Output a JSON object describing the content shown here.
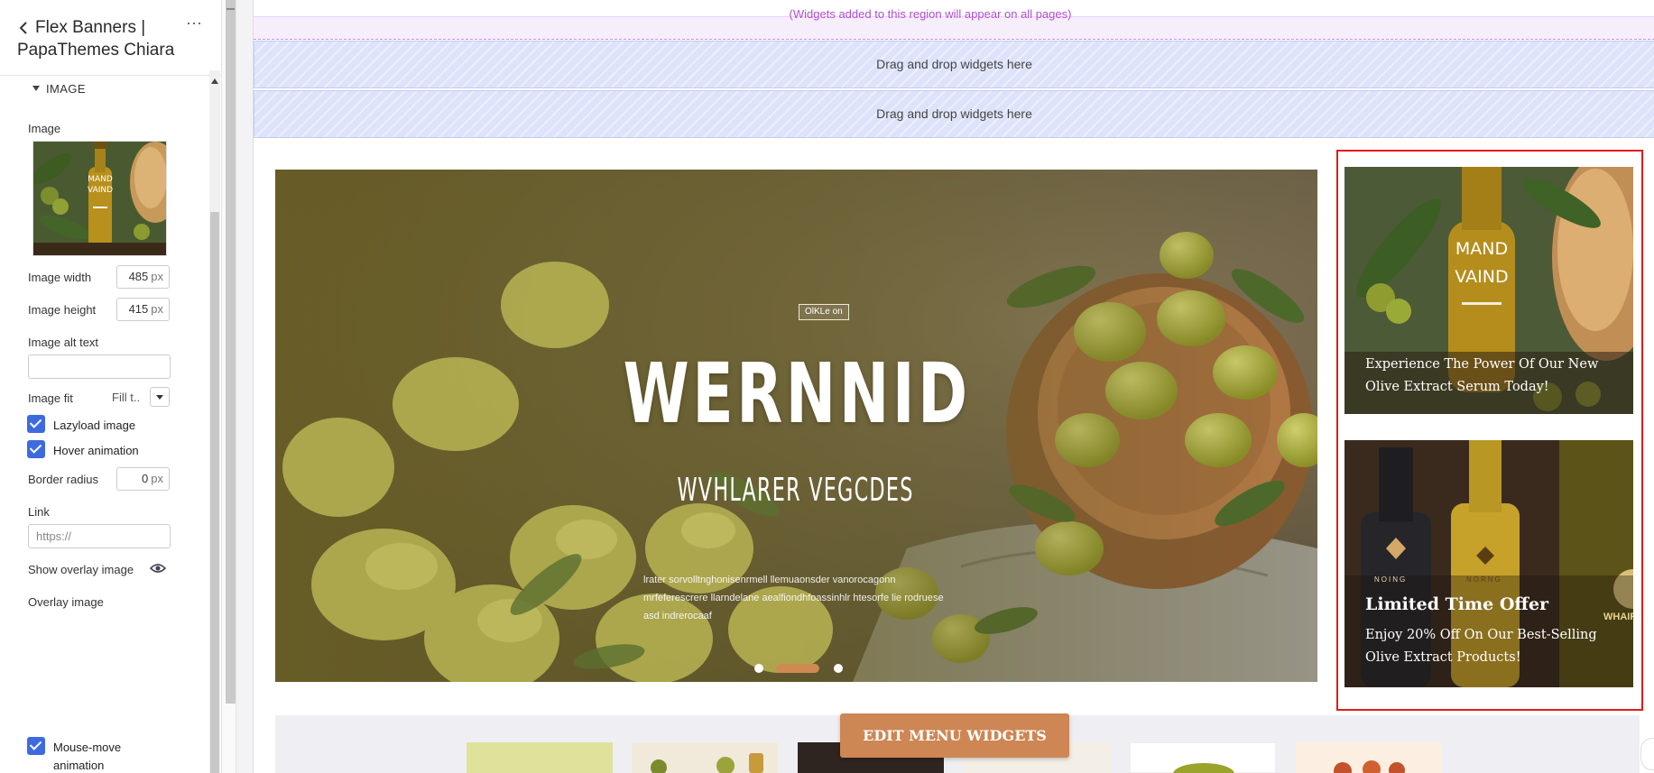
{
  "panel": {
    "title_line1": "Flex Banners |",
    "title_line2": "PapaThemes Chiara",
    "section_label": "IMAGE",
    "image_label": "Image",
    "thumb_text_line1": "MAND",
    "thumb_text_line2": "VAIND",
    "image_width_label": "Image width",
    "image_width_value": "485",
    "image_height_label": "Image height",
    "image_height_value": "415",
    "unit": "px",
    "alt_text_label": "Image alt text",
    "alt_text_value": "",
    "image_fit_label": "Image fit",
    "image_fit_value": "Fill t..",
    "lazyload_label": "Lazyload image",
    "hover_label": "Hover animation",
    "border_radius_label": "Border radius",
    "border_radius_value": "0",
    "link_label": "Link",
    "link_placeholder": "https://",
    "overlay_show_label": "Show overlay image",
    "overlay_image_label": "Overlay image",
    "mouse_move_label_line1": "Mouse-move",
    "mouse_move_label_line2": "animation"
  },
  "canvas": {
    "global_region_note": "(Widgets added to this region will appear on all pages)",
    "drop_zone_1": "Drag and drop widgets here",
    "drop_zone_2": "Drag and drop widgets here",
    "slide": {
      "badge": "OlKLe on",
      "title": "WERNNID",
      "subtitle": "WVHLARER VEGCDES",
      "body": "lrater sorvolltnghonisenrmell llemuaonsder vanorocagonn mrfeferescrere llarndelane aealfiondhfoassinhlr htesorfe lie rodruese asd indrerocaaf"
    },
    "banner_top": {
      "bottle_line1": "MAND",
      "bottle_line2": "VAIND",
      "text": "Experience The Power Of Our New Olive Extract Serum Today!"
    },
    "banner_bottom": {
      "title": "Limited Time Offer",
      "text": "Enjoy 20% Off On Our Best-Selling Olive Extract Products!",
      "brand_left": "NOING",
      "brand_right": "NORNG",
      "side_brand": "WHAIR"
    },
    "edit_button": "EDIT MENU WIDGETS"
  },
  "colors": {
    "accent_blue": "#3d6bdf",
    "selection_red": "#e21a1a",
    "edit_button": "#cd8654",
    "drop_zone": "#dde3fb",
    "global_region_text": "#b04dd6"
  },
  "icons": [
    "back-chevron-icon",
    "more-dots-icon",
    "caret-down-icon",
    "eye-icon",
    "checkbox-checked-icon",
    "chevron-down-icon"
  ]
}
